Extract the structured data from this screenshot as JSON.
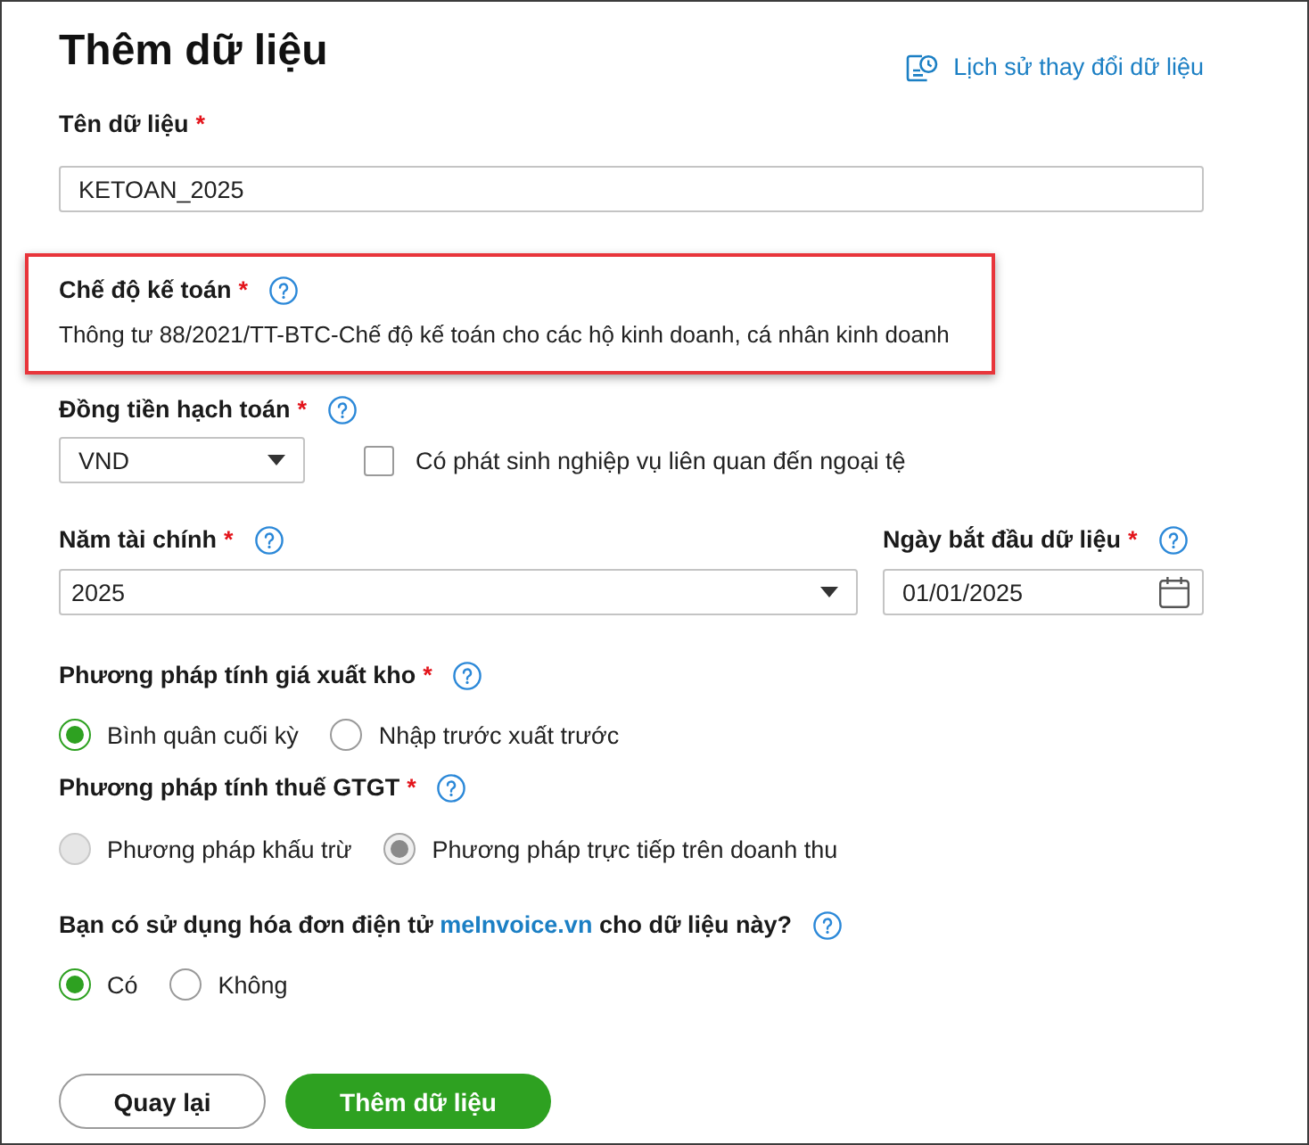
{
  "title": "Thêm dữ liệu",
  "history_link": {
    "label": "Lịch sử thay đổi dữ liệu"
  },
  "data_name": {
    "label": "Tên dữ liệu",
    "required_mark": "*",
    "value": "KETOAN_2025"
  },
  "accounting_regime": {
    "label": "Chế độ kế toán",
    "required_mark": "*",
    "help": true,
    "value": "Thông tư 88/2021/TT-BTC-Chế độ kế toán cho các hộ kinh doanh, cá nhân kinh doanh",
    "highlighted": true
  },
  "currency": {
    "label": "Đồng tiền hạch toán",
    "required_mark": "*",
    "help": true,
    "value": "VND",
    "foreign_currency": {
      "label": "Có phát sinh nghiệp vụ liên quan đến ngoại tệ",
      "checked": false
    }
  },
  "fiscal_year": {
    "label": "Năm tài chính",
    "required_mark": "*",
    "help": true,
    "value": "2025"
  },
  "start_date": {
    "label": "Ngày bắt đầu dữ liệu",
    "required_mark": "*",
    "help": true,
    "value": "01/01/2025"
  },
  "inventory_method": {
    "label": "Phương pháp tính giá xuất kho",
    "required_mark": "*",
    "help": true,
    "disabled": false,
    "options": [
      {
        "label": "Bình quân cuối kỳ",
        "selected": true
      },
      {
        "label": "Nhập trước xuất trước",
        "selected": false
      }
    ]
  },
  "vat_method": {
    "label": "Phương pháp tính thuế GTGT",
    "required_mark": "*",
    "help": true,
    "disabled": true,
    "options": [
      {
        "label": "Phương pháp khấu trừ",
        "selected": false
      },
      {
        "label": "Phương pháp trực tiếp trên doanh thu",
        "selected": true
      }
    ]
  },
  "e_invoice": {
    "text_before": "Bạn có sử dụng hóa đơn điện tử",
    "link": "meInvoice.vn",
    "text_after": "cho dữ liệu này?",
    "help": true,
    "disabled": false,
    "options": [
      {
        "label": "Có",
        "selected": true
      },
      {
        "label": "Không",
        "selected": false
      }
    ]
  },
  "buttons": [
    {
      "label": "Quay lại",
      "kind": "secondary"
    },
    {
      "label": "Thêm dữ liệu",
      "kind": "primary"
    }
  ]
}
